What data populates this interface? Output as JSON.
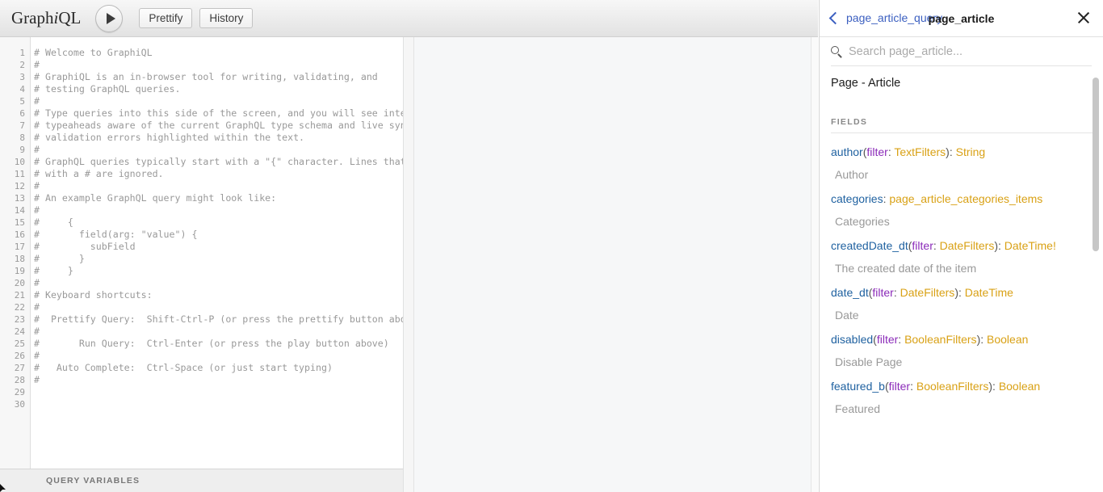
{
  "toolbar": {
    "logo_pre": "Graph",
    "logo_i": "i",
    "logo_post": "QL",
    "execute_label": "execute-query",
    "prettify_label": "Prettify",
    "history_label": "History"
  },
  "editor": {
    "variables_label": "QUERY VARIABLES",
    "total_lines": 30,
    "lines": [
      "# Welcome to GraphiQL",
      "#",
      "# GraphiQL is an in-browser tool for writing, validating, and",
      "# testing GraphQL queries.",
      "#",
      "# Type queries into this side of the screen, and you will see intelligent",
      "# typeaheads aware of the current GraphQL type schema and live syntax and",
      "# validation errors highlighted within the text.",
      "#",
      "# GraphQL queries typically start with a \"{\" character. Lines that start",
      "# with a # are ignored.",
      "#",
      "# An example GraphQL query might look like:",
      "#",
      "#     {",
      "#       field(arg: \"value\") {",
      "#         subField",
      "#       }",
      "#     }",
      "#",
      "# Keyboard shortcuts:",
      "#",
      "#  Prettify Query:  Shift-Ctrl-P (or press the prettify button above)",
      "#",
      "#       Run Query:  Ctrl-Enter (or press the play button above)",
      "#",
      "#   Auto Complete:  Ctrl-Space (or just start typing)",
      "#",
      "",
      ""
    ]
  },
  "docs": {
    "back_label": "page_article_query",
    "title": "page_article",
    "close_label": "Close documentation explorer",
    "search_placeholder": "Search page_article...",
    "search_value": "",
    "type_name": "Page - Article",
    "fields_section_label": "FIELDS",
    "fields": [
      {
        "name": "author",
        "args": [
          {
            "name": "filter",
            "type": "TextFilters"
          }
        ],
        "type": "String",
        "non_null": false,
        "description": "Author"
      },
      {
        "name": "categories",
        "args": [],
        "type": "page_article_categories_items",
        "non_null": false,
        "description": "Categories"
      },
      {
        "name": "createdDate_dt",
        "args": [
          {
            "name": "filter",
            "type": "DateFilters"
          }
        ],
        "type": "DateTime",
        "non_null": true,
        "description": "The created date of the item"
      },
      {
        "name": "date_dt",
        "args": [
          {
            "name": "filter",
            "type": "DateFilters"
          }
        ],
        "type": "DateTime",
        "non_null": false,
        "description": "Date"
      },
      {
        "name": "disabled",
        "args": [
          {
            "name": "filter",
            "type": "BooleanFilters"
          }
        ],
        "type": "Boolean",
        "non_null": false,
        "description": "Disable Page"
      },
      {
        "name": "featured_b",
        "args": [
          {
            "name": "filter",
            "type": "BooleanFilters"
          }
        ],
        "type": "Boolean",
        "non_null": false,
        "description": "Featured"
      }
    ]
  },
  "colors": {
    "field_name": "#1f61a0",
    "arg_name": "#8b2bb9",
    "type_name": "#d9a115",
    "link_blue": "#3b5fc0",
    "description": "#999999"
  }
}
